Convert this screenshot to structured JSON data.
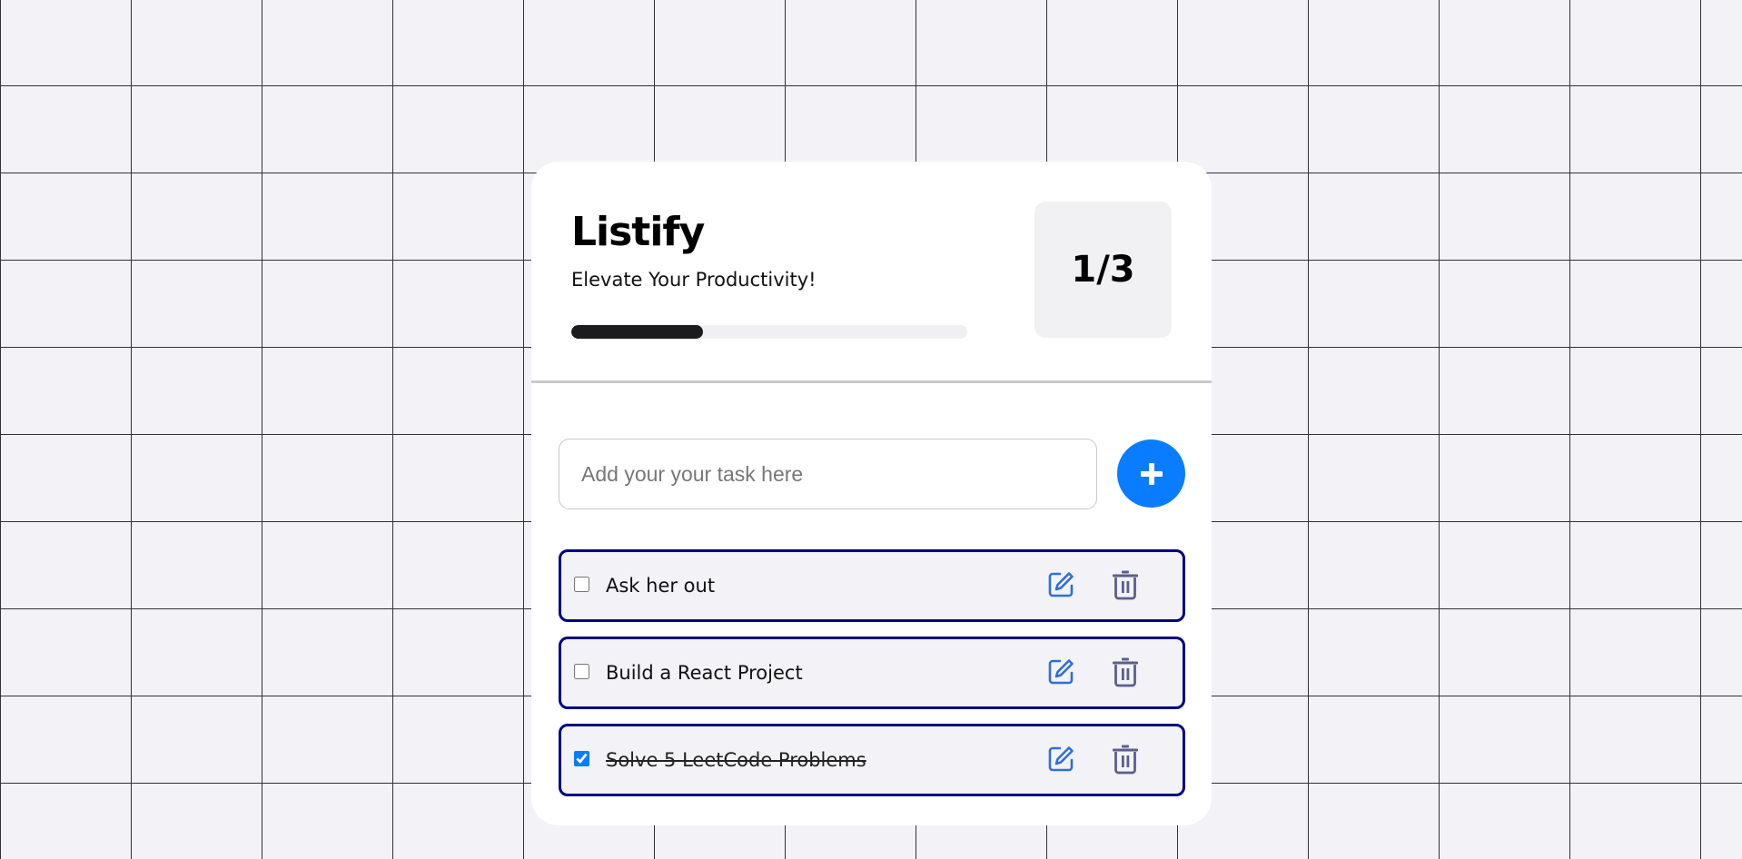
{
  "app": {
    "title": "Listify",
    "tagline": "Elevate Your Productivity!"
  },
  "progress": {
    "completed": 1,
    "total": 3,
    "label": "1/3",
    "fraction": 0.333
  },
  "input": {
    "placeholder": "Add your your task here",
    "value": ""
  },
  "add_button": {
    "icon": "plus-icon"
  },
  "tasks": [
    {
      "text": "Ask her out",
      "completed": false
    },
    {
      "text": "Build a React Project",
      "completed": false
    },
    {
      "text": "Solve 5 LeetCode Problems",
      "completed": true
    }
  ],
  "colors": {
    "accent": "#0a7cff",
    "task_border": "#000080",
    "edit_icon": "#2f6fd8",
    "delete_icon": "#5b5f8a",
    "progress_fill": "#1c1c1e",
    "background": "#f2f2f7"
  },
  "icons": {
    "edit": "edit-icon",
    "delete": "trash-icon"
  }
}
